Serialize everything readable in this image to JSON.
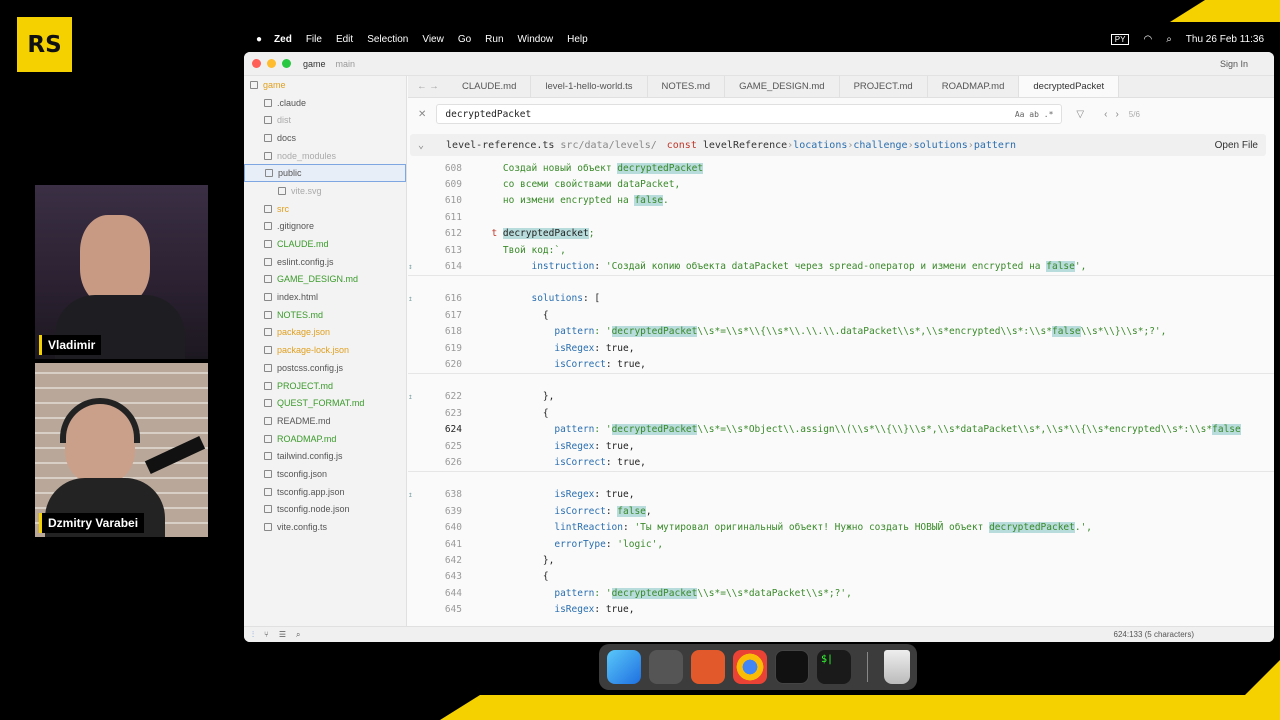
{
  "brand": {
    "logo": "RS"
  },
  "participants": [
    {
      "name": "Vladimir"
    },
    {
      "name": "Dzmitry Varabei"
    }
  ],
  "menubar": {
    "app": "Zed",
    "items": [
      "File",
      "Edit",
      "Selection",
      "View",
      "Go",
      "Run",
      "Window",
      "Help"
    ],
    "clock": "Thu 26 Feb 11:36",
    "lang": "PY"
  },
  "window": {
    "project": "game",
    "branch": "main",
    "sign_in": "Sign In"
  },
  "sidebar": {
    "items": [
      {
        "label": "game",
        "color": "#e0a020",
        "indent": 0
      },
      {
        "label": ".claude",
        "color": "#555",
        "indent": 1
      },
      {
        "label": "dist",
        "color": "#aaa",
        "indent": 1
      },
      {
        "label": "docs",
        "color": "#555",
        "indent": 1
      },
      {
        "label": "node_modules",
        "color": "#aaa",
        "indent": 1
      },
      {
        "label": "public",
        "color": "#555",
        "indent": 1
      },
      {
        "label": "vite.svg",
        "color": "#aaa",
        "indent": 2
      },
      {
        "label": "src",
        "color": "#e0a020",
        "indent": 1
      },
      {
        "label": ".gitignore",
        "color": "#555",
        "indent": 1
      },
      {
        "label": "CLAUDE.md",
        "color": "#3a9a2a",
        "indent": 1
      },
      {
        "label": "eslint.config.js",
        "color": "#555",
        "indent": 1
      },
      {
        "label": "GAME_DESIGN.md",
        "color": "#3a9a2a",
        "indent": 1
      },
      {
        "label": "index.html",
        "color": "#555",
        "indent": 1
      },
      {
        "label": "NOTES.md",
        "color": "#3a9a2a",
        "indent": 1
      },
      {
        "label": "package.json",
        "color": "#e0a020",
        "indent": 1
      },
      {
        "label": "package-lock.json",
        "color": "#e0a020",
        "indent": 1
      },
      {
        "label": "postcss.config.js",
        "color": "#555",
        "indent": 1
      },
      {
        "label": "PROJECT.md",
        "color": "#3a9a2a",
        "indent": 1
      },
      {
        "label": "QUEST_FORMAT.md",
        "color": "#3a9a2a",
        "indent": 1
      },
      {
        "label": "README.md",
        "color": "#555",
        "indent": 1
      },
      {
        "label": "ROADMAP.md",
        "color": "#3a9a2a",
        "indent": 1
      },
      {
        "label": "tailwind.config.js",
        "color": "#555",
        "indent": 1
      },
      {
        "label": "tsconfig.json",
        "color": "#555",
        "indent": 1
      },
      {
        "label": "tsconfig.app.json",
        "color": "#555",
        "indent": 1
      },
      {
        "label": "tsconfig.node.json",
        "color": "#555",
        "indent": 1
      },
      {
        "label": "vite.config.ts",
        "color": "#555",
        "indent": 1
      }
    ]
  },
  "tabs": [
    "CLAUDE.md",
    "level-1-hello-world.ts",
    "NOTES.md",
    "GAME_DESIGN.md",
    "PROJECT.md",
    "ROADMAP.md",
    "decryptedPacket"
  ],
  "search": {
    "query": "decryptedPacket",
    "options": "Aa  ab  .*",
    "count": "5/6"
  },
  "breadcrumb": {
    "file": "level-reference.ts",
    "path": "src/data/levels/",
    "kw": "const",
    "name": "levelReference",
    "parts": [
      "locations",
      "challenge",
      "solutions",
      "pattern"
    ],
    "open_file": "Open File"
  },
  "code": [
    {
      "n": "608",
      "segs": [
        [
          "    Создай новый объект ",
          "str"
        ],
        [
          "decryptedPacket",
          "str hl"
        ]
      ]
    },
    {
      "n": "609",
      "segs": [
        [
          "    со всеми свойствами dataPacket,",
          "str"
        ]
      ]
    },
    {
      "n": "610",
      "segs": [
        [
          "    но измени encrypted на ",
          "str"
        ],
        [
          "false",
          "str hl"
        ],
        [
          ".",
          "str"
        ]
      ]
    },
    {
      "n": "611",
      "segs": []
    },
    {
      "n": "612",
      "segs": [
        [
          "  t ",
          "kw"
        ],
        [
          "decryptedPacket",
          "txt hl"
        ],
        [
          ";",
          "str"
        ]
      ]
    },
    {
      "n": "613",
      "segs": [
        [
          "    Твой код:`,",
          "str"
        ]
      ]
    },
    {
      "n": "614",
      "g": "↕",
      "segs": [
        [
          "         instruction",
          "key"
        ],
        [
          ": ",
          "txt"
        ],
        [
          "'Создай копию объекта dataPacket через spread-оператор и измени encrypted на ",
          "str"
        ],
        [
          "false",
          "str hl"
        ],
        [
          "',",
          "str"
        ]
      ]
    },
    {
      "sep": true
    },
    {
      "n": "616",
      "g": "↥",
      "segs": [
        [
          "         solutions",
          "key"
        ],
        [
          ": [",
          "txt"
        ]
      ]
    },
    {
      "n": "617",
      "segs": [
        [
          "           {",
          "txt"
        ]
      ]
    },
    {
      "n": "618",
      "segs": [
        [
          "             pattern",
          "key"
        ],
        [
          ": '",
          "str"
        ],
        [
          "decryptedPacket",
          "str hl"
        ],
        [
          "\\\\s*=\\\\s*\\\\{\\\\s*\\\\.\\\\.\\\\.dataPacket\\\\s*,\\\\s*encrypted\\\\s*:\\\\s*",
          "str"
        ],
        [
          "false",
          "str hl"
        ],
        [
          "\\\\s*\\\\}\\\\s*;?',",
          "str"
        ]
      ]
    },
    {
      "n": "619",
      "segs": [
        [
          "             isRegex",
          "key"
        ],
        [
          ": true,",
          "txt"
        ]
      ]
    },
    {
      "n": "620",
      "segs": [
        [
          "             isCorrect",
          "key"
        ],
        [
          ": true,",
          "txt"
        ]
      ]
    },
    {
      "sep": true
    },
    {
      "n": "622",
      "g": "↥",
      "segs": [
        [
          "           },",
          "txt"
        ]
      ]
    },
    {
      "n": "623",
      "segs": [
        [
          "           {",
          "txt"
        ]
      ]
    },
    {
      "n": "624",
      "cur": true,
      "segs": [
        [
          "             pattern",
          "key"
        ],
        [
          ": '",
          "str"
        ],
        [
          "decryptedPacket",
          "str hl"
        ],
        [
          "\\\\s*=\\\\s*Object\\\\.assign\\\\(\\\\s*\\\\{\\\\}\\\\s*,\\\\s*dataPacket\\\\s*,\\\\s*\\\\{\\\\s*encrypted\\\\s*:\\\\s*",
          "str"
        ],
        [
          "false",
          "str hl"
        ]
      ]
    },
    {
      "n": "625",
      "segs": [
        [
          "             isRegex",
          "key"
        ],
        [
          ": true,",
          "txt"
        ]
      ]
    },
    {
      "n": "626",
      "segs": [
        [
          "             isCorrect",
          "key"
        ],
        [
          ": true,",
          "txt"
        ]
      ]
    },
    {
      "sep": true
    },
    {
      "n": "638",
      "g": "↥",
      "segs": [
        [
          "             isRegex",
          "key"
        ],
        [
          ": true,",
          "txt"
        ]
      ]
    },
    {
      "n": "639",
      "segs": [
        [
          "             isCorrect",
          "key"
        ],
        [
          ": ",
          "txt"
        ],
        [
          "false",
          "str hl"
        ],
        [
          ",",
          "txt"
        ]
      ]
    },
    {
      "n": "640",
      "segs": [
        [
          "             lintReaction",
          "key"
        ],
        [
          ": ",
          "txt"
        ],
        [
          "'Ты мутировал оригинальный объект! Нужно создать НОВЫЙ объект ",
          "str"
        ],
        [
          "decryptedPacket",
          "str hl"
        ],
        [
          ".',",
          "str"
        ]
      ]
    },
    {
      "n": "641",
      "segs": [
        [
          "             errorType",
          "key"
        ],
        [
          ": ",
          "txt"
        ],
        [
          "'logic',",
          "str"
        ]
      ]
    },
    {
      "n": "642",
      "segs": [
        [
          "           },",
          "txt"
        ]
      ]
    },
    {
      "n": "643",
      "segs": [
        [
          "           {",
          "txt"
        ]
      ]
    },
    {
      "n": "644",
      "segs": [
        [
          "             pattern",
          "key"
        ],
        [
          ": '",
          "str"
        ],
        [
          "decryptedPacket",
          "str hl"
        ],
        [
          "\\\\s*=\\\\s*dataPacket\\\\s*;?',",
          "str"
        ]
      ]
    },
    {
      "n": "645",
      "segs": [
        [
          "             isRegex",
          "key"
        ],
        [
          ": true,",
          "txt"
        ]
      ]
    }
  ],
  "status": {
    "cursor": "624:133 (5 characters)"
  }
}
